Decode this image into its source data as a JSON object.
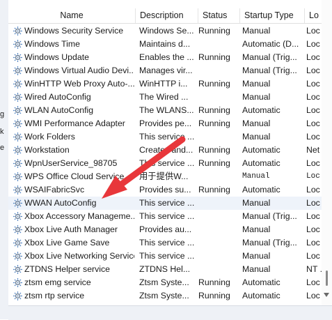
{
  "columns": {
    "name": "Name",
    "description": "Description",
    "status": "Status",
    "startup_type": "Startup Type",
    "log_on_as": "Lo"
  },
  "left_fragments": [
    "g",
    "k",
    "e"
  ],
  "selected_row": 13,
  "services": [
    {
      "name": "Windows Security Service",
      "description": "Windows Se...",
      "status": "Running",
      "startup": "Manual",
      "log": "Loc"
    },
    {
      "name": "Windows Time",
      "description": "Maintains d...",
      "status": "",
      "startup": "Automatic (D...",
      "log": "Loc"
    },
    {
      "name": "Windows Update",
      "description": "Enables the ...",
      "status": "Running",
      "startup": "Manual (Trig...",
      "log": "Loc"
    },
    {
      "name": "Windows Virtual Audio Devi...",
      "description": "Manages vir...",
      "status": "",
      "startup": "Manual (Trig...",
      "log": "Loc"
    },
    {
      "name": "WinHTTP Web Proxy Auto-...",
      "description": "WinHTTP i...",
      "status": "Running",
      "startup": "Manual",
      "log": "Loc"
    },
    {
      "name": "Wired AutoConfig",
      "description": "The Wired ...",
      "status": "",
      "startup": "Manual",
      "log": "Loc"
    },
    {
      "name": "WLAN AutoConfig",
      "description": "The WLANS...",
      "status": "Running",
      "startup": "Automatic",
      "log": "Loc"
    },
    {
      "name": "WMI Performance Adapter",
      "description": "Provides pe...",
      "status": "Running",
      "startup": "Manual",
      "log": "Loc"
    },
    {
      "name": "Work Folders",
      "description": "This service ...",
      "status": "",
      "startup": "Manual",
      "log": "Loc"
    },
    {
      "name": "Workstation",
      "description": "Creates and...",
      "status": "Running",
      "startup": "Automatic",
      "log": "Net"
    },
    {
      "name": "WpnUserService_98705",
      "description": "This service ...",
      "status": "Running",
      "startup": "Automatic",
      "log": "Loc"
    },
    {
      "name": "WPS Office Cloud Service",
      "description": "用于提供W...",
      "status": "",
      "startup": "Manual",
      "log": "Loc",
      "mono": true
    },
    {
      "name": "WSAIFabricSvc",
      "description": "Provides su...",
      "status": "Running",
      "startup": "Automatic",
      "log": "Loc"
    },
    {
      "name": "WWAN AutoConfig",
      "description": "This service ...",
      "status": "",
      "startup": "Manual",
      "log": "Loc"
    },
    {
      "name": "Xbox Accessory Manageme...",
      "description": "This service ...",
      "status": "",
      "startup": "Manual (Trig...",
      "log": "Loc"
    },
    {
      "name": "Xbox Live Auth Manager",
      "description": "Provides au...",
      "status": "",
      "startup": "Manual",
      "log": "Loc"
    },
    {
      "name": "Xbox Live Game Save",
      "description": "This service ...",
      "status": "",
      "startup": "Manual (Trig...",
      "log": "Loc"
    },
    {
      "name": "Xbox Live Networking Service",
      "description": "This service ...",
      "status": "",
      "startup": "Manual",
      "log": "Loc"
    },
    {
      "name": "ZTDNS Helper service",
      "description": "ZTDNS Hel...",
      "status": "",
      "startup": "Manual",
      "log": "NT ."
    },
    {
      "name": "ztsm emg service",
      "description": "Ztsm Syste...",
      "status": "Running",
      "startup": "Automatic",
      "log": "Loc"
    },
    {
      "name": "ztsm rtp service",
      "description": "Ztsm Syste...",
      "status": "Running",
      "startup": "Automatic",
      "log": "Loc"
    }
  ],
  "annotation": {
    "color": "#e8373b",
    "icon": "red-pointer-arrow"
  }
}
